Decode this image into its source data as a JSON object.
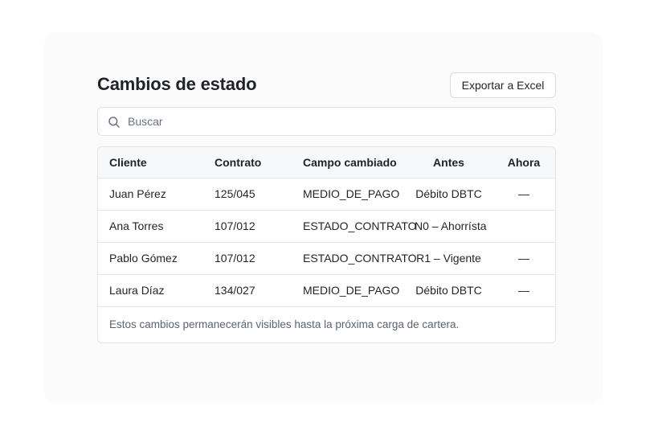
{
  "header": {
    "title": "Cambios de estado",
    "export_label": "Exportar a Excel"
  },
  "search": {
    "placeholder": "Buscar",
    "value": ""
  },
  "table": {
    "columns": [
      "Cliente",
      "Contrato",
      "Campo cambiado",
      "Antes",
      "Ahora"
    ],
    "rows": [
      [
        "Juan Pérez",
        "125/045",
        "MEDIO_DE_PAGO",
        "Débito DBTC",
        "—"
      ],
      [
        "Ana Torres",
        "107/012",
        "ESTADO_CONTRATO",
        "N0 – Ahorrísta",
        ""
      ],
      [
        "Pablo Gómez",
        "107/012",
        "ESTADO_CONTRATO",
        "R1 – Vigente",
        "—"
      ],
      [
        "Laura Díaz",
        "134/027",
        "MEDIO_DE_PAGO",
        "Débito DBTC",
        "—"
      ]
    ],
    "footnote": "Estos cambios permanecerán visibles hasta la próxima carga de cartera."
  },
  "icons": {
    "search": "search-icon"
  }
}
